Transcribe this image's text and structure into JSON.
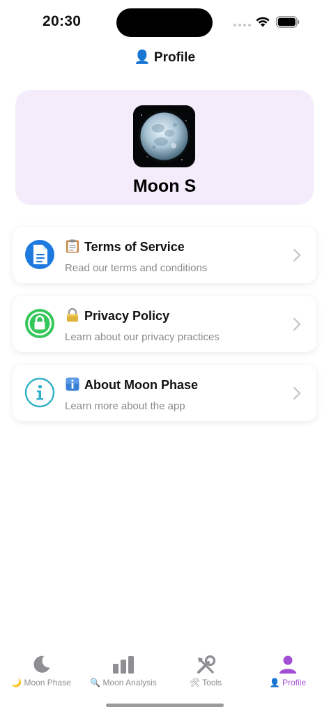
{
  "status": {
    "time": "20:30"
  },
  "header": {
    "icon": "person-icon",
    "title": "👤 Profile"
  },
  "profile": {
    "name": "Moon S",
    "avatar": "moon-photo"
  },
  "menu": [
    {
      "icon": "document-icon",
      "emoji": "clipboard",
      "title": "Terms of Service",
      "subtitle": "Read our terms and conditions",
      "color": "#1f7ae0"
    },
    {
      "icon": "lock-icon",
      "emoji": "lock",
      "title": "Privacy Policy",
      "subtitle": "Learn about our privacy practices",
      "color": "#34c759"
    },
    {
      "icon": "info-icon",
      "emoji": "info",
      "title": "About Moon Phase",
      "subtitle": "Learn more about the app",
      "color": "#30b0c7"
    }
  ],
  "tabs": [
    {
      "label": "🌙 Moon Phase",
      "icon": "moon-icon"
    },
    {
      "label": "🔍 Moon Analysis",
      "icon": "bar-chart-icon"
    },
    {
      "label": "🛠 Tools",
      "icon": "tools-icon"
    },
    {
      "label": "👤 Profile",
      "icon": "person-icon",
      "active": true
    }
  ],
  "colors": {
    "accent": "#a24fd6",
    "card_bg": "#f4ecfb",
    "muted": "#8e8e93"
  }
}
